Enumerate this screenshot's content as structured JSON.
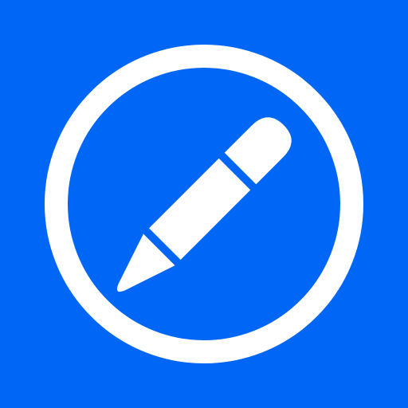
{
  "icon": {
    "name": "edit-icon",
    "background_color": "#0066f5",
    "foreground_color": "#ffffff",
    "glyph": "pencil-icon"
  }
}
